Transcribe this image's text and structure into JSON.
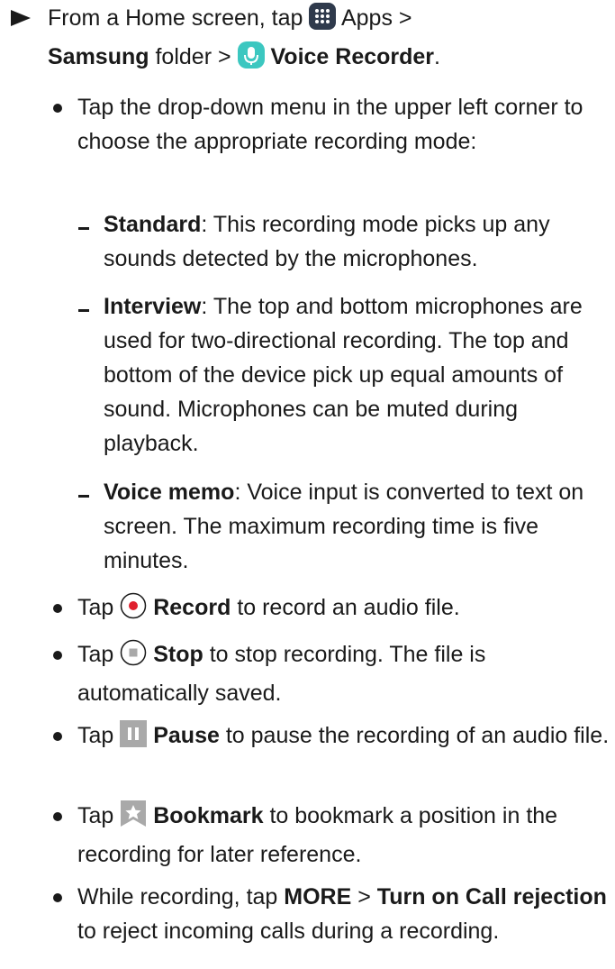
{
  "step": {
    "prefix": "From a Home screen, tap",
    "apps": "Apps >",
    "samsung": "Samsung",
    "folder": "folder >",
    "voice_recorder": "Voice Recorder",
    "end": "."
  },
  "bullets": {
    "dropdown": "Tap the drop-down menu in the upper left corner to choose the appropriate recording mode:",
    "modes": [
      {
        "name": "Standard",
        "text": ": This recording mode picks up any sounds detected by the microphones."
      },
      {
        "name": "Interview",
        "text": ": The top and bottom microphones are used for two-directional recording. The top and bottom of the device pick up equal amounts of sound. Microphones can be muted during playback."
      },
      {
        "name": "Voice memo",
        "text": ": Voice input is converted to text on screen. The maximum recording time is five minutes."
      }
    ],
    "tap": "Tap",
    "record": {
      "label": "Record",
      "text": "to record an audio file."
    },
    "stop": {
      "label": "Stop",
      "text": "to stop recording. The file is automatically saved."
    },
    "pause": {
      "label": "Pause",
      "text": "to pause the recording of an audio file."
    },
    "bookmark": {
      "label": "Bookmark",
      "text": "to bookmark a position in the recording for later reference."
    },
    "more": {
      "prefix": "While recording, tap",
      "more_label": "MORE",
      "sep": ">",
      "turn_on": "Turn on Call rejection",
      "text": "to reject incoming calls during a recording."
    }
  },
  "colors": {
    "text": "#1a1a1a",
    "record_red": "#e0202e",
    "icon_gray": "#a9a9a9",
    "apps_dark": "#2f3a4c",
    "recorder_teal": "#3cc7c0"
  }
}
